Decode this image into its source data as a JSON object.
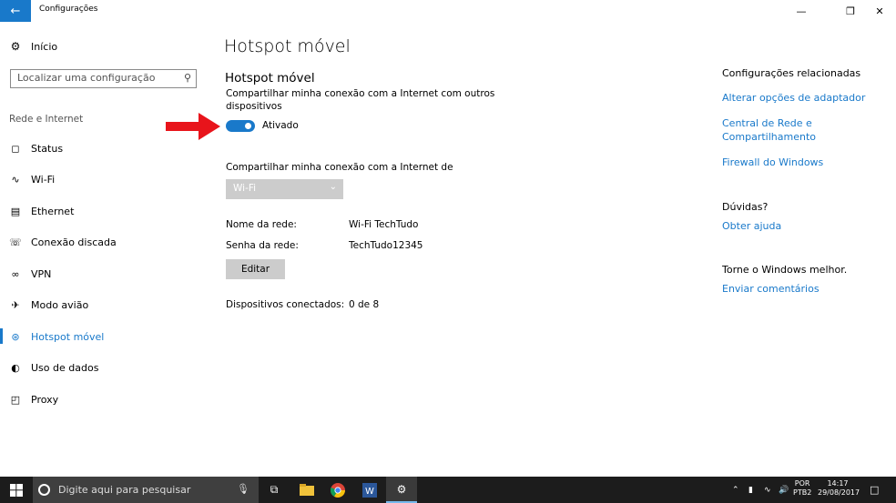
{
  "window": {
    "title": "Configurações",
    "back_icon": "arrow-left-icon",
    "minimize": "—",
    "maximize": "❐",
    "close": "✕"
  },
  "sidebar": {
    "home_label": "Início",
    "search_placeholder": "Localizar uma configuração",
    "section_label": "Rede e Internet",
    "items": [
      {
        "label": "Status",
        "icon": "status-icon"
      },
      {
        "label": "Wi-Fi",
        "icon": "wifi-icon"
      },
      {
        "label": "Ethernet",
        "icon": "ethernet-icon"
      },
      {
        "label": "Conexão discada",
        "icon": "dialup-icon"
      },
      {
        "label": "VPN",
        "icon": "vpn-icon"
      },
      {
        "label": "Modo avião",
        "icon": "airplane-icon"
      },
      {
        "label": "Hotspot móvel",
        "icon": "hotspot-icon",
        "active": true
      },
      {
        "label": "Uso de dados",
        "icon": "data-usage-icon"
      },
      {
        "label": "Proxy",
        "icon": "globe-icon"
      }
    ]
  },
  "main": {
    "page_title": "Hotspot móvel",
    "section_title": "Hotspot móvel",
    "share_description": "Compartilhar minha conexão com a Internet com outros dispositivos",
    "toggle_state": "Ativado",
    "toggle_on": true,
    "share_from_label": "Compartilhar minha conexão com a Internet de",
    "share_from_value": "Wi-Fi",
    "network_name_label": "Nome da rede:",
    "network_name_value": "Wi-Fi TechTudo",
    "password_label": "Senha da rede:",
    "password_value": "TechTudo12345",
    "edit_button": "Editar",
    "devices_label": "Dispositivos conectados:",
    "devices_value": "0 de 8"
  },
  "related": {
    "title": "Configurações relacionadas",
    "link1": "Alterar opções de adaptador",
    "link2": "Central de Rede e Compartilhamento",
    "link3": "Firewall do Windows",
    "questions_title": "Dúvidas?",
    "help_link": "Obter ajuda",
    "improve_title": "Torne o Windows melhor.",
    "feedback_link": "Enviar comentários"
  },
  "taskbar": {
    "search_placeholder": "Digite aqui para pesquisar",
    "lang_line1": "POR",
    "lang_line2": "PTB2",
    "time": "14:17",
    "date": "29/08/2017"
  },
  "colors": {
    "accent": "#1979ca",
    "arrow": "#e8141b",
    "taskbar": "#1c1c1c"
  }
}
